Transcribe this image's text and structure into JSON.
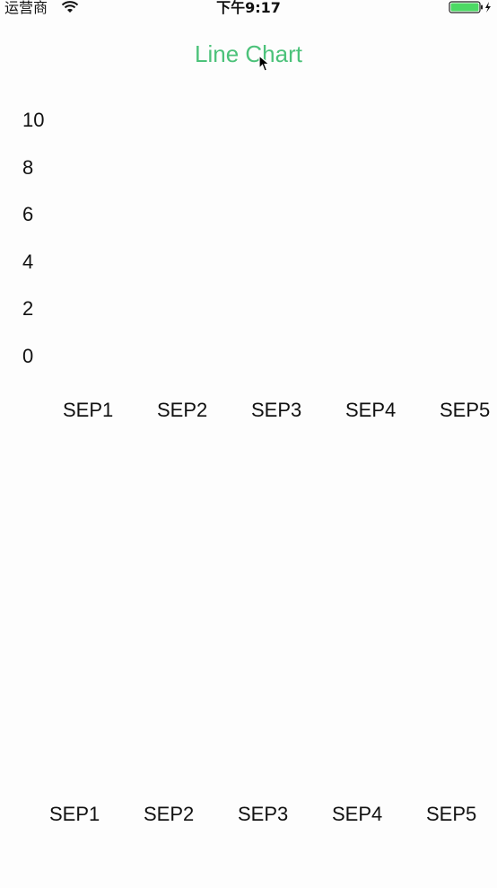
{
  "status_bar": {
    "carrier": "运营商",
    "time": "下午9:17",
    "battery_color": "#4cd964"
  },
  "nav": {
    "title": "Line Chart",
    "title_color": "#4cc27a"
  },
  "chart_data": [
    {
      "type": "line",
      "categories": [
        "SEP1",
        "SEP2",
        "SEP3",
        "SEP4",
        "SEP5"
      ],
      "y_ticks": [
        "10",
        "8",
        "6",
        "4",
        "2",
        "0"
      ],
      "series": [],
      "ylim": [
        0,
        10
      ]
    },
    {
      "type": "line",
      "categories": [
        "SEP1",
        "SEP2",
        "SEP3",
        "SEP4",
        "SEP5"
      ],
      "y_ticks": [],
      "series": []
    }
  ]
}
